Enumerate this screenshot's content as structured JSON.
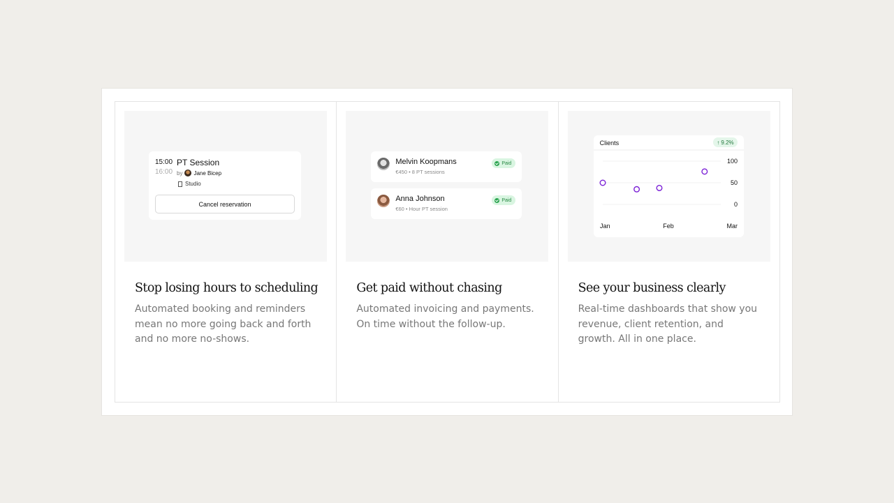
{
  "features": [
    {
      "title": "Stop losing hours to scheduling",
      "description": "Automated booking and reminders mean no more going back and forth and no more no-shows."
    },
    {
      "title": "Get paid without chasing",
      "description": "Automated invoicing and payments. On time without the follow-up."
    },
    {
      "title": "See your business clearly",
      "description": "Real-time dashboards that show you revenue, client retention, and growth. All in one place."
    }
  ],
  "booking": {
    "start_time": "15:00",
    "end_time": "16:00",
    "session_title": "PT Session",
    "by_label": "by",
    "trainer": "Jane Bicep",
    "location": "Studio",
    "cancel_label": "Cancel reservation"
  },
  "payments": [
    {
      "name": "Melvin Koopmans",
      "meta": "€450 • 8 PT sessions",
      "status": "Paid"
    },
    {
      "name": "Anna Johnson",
      "meta": "€60 • Hour PT session",
      "status": "Paid"
    }
  ],
  "colors": {
    "accent": "#7a1fd6",
    "paid_green": "#2aa44f",
    "background": "#f0eeea"
  },
  "chart_data": {
    "type": "scatter",
    "title": "Clients",
    "change": "9.2%",
    "change_direction": "up",
    "x_ticks": [
      "Jan",
      "Feb",
      "Mar"
    ],
    "y_ticks": [
      "100",
      "50",
      "0"
    ],
    "ylim": [
      0,
      100
    ],
    "points": [
      {
        "x": 0.0,
        "y": 50
      },
      {
        "x": 0.6,
        "y": 35
      },
      {
        "x": 1.0,
        "y": 38
      },
      {
        "x": 1.8,
        "y": 76
      }
    ],
    "xlim": [
      0,
      2
    ],
    "grid": true
  }
}
